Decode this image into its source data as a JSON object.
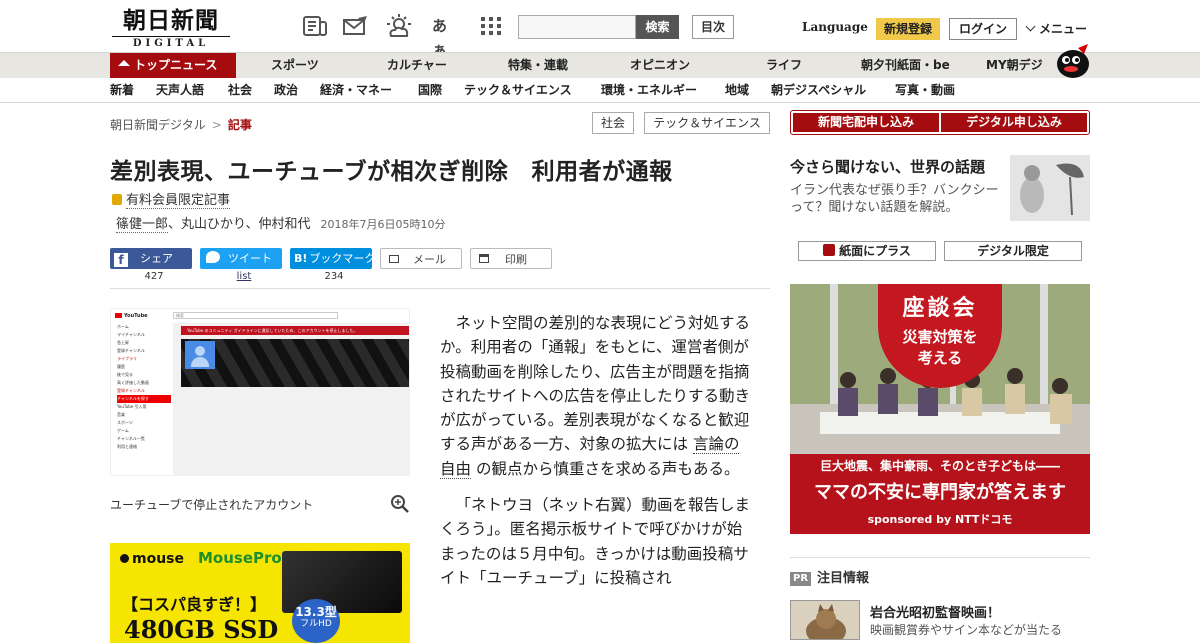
{
  "header": {
    "logo_jp": "朝日新聞",
    "logo_en": "DIGITAL",
    "icons": [
      "newspaper-icon",
      "mail-icon",
      "weather-icon",
      "font-size-icon",
      "apps-grid-icon"
    ],
    "font_icon_text": "あぁ",
    "search_placeholder": "",
    "search_button": "検索",
    "contents_button": "目次",
    "language": "Language",
    "register": "新規登録",
    "login": "ログイン",
    "menu": "メニュー"
  },
  "nav_primary": {
    "top": "トップニュース",
    "items": [
      "スポーツ",
      "カルチャー",
      "特集・連載",
      "オピニオン",
      "ライフ",
      "朝夕刊紙面・be",
      "MY朝デジ"
    ]
  },
  "nav_secondary": {
    "items": [
      "新着",
      "天声人語",
      "社会",
      "政治",
      "経済・マネー",
      "国際",
      "テック＆サイエンス",
      "環境・エネルギー",
      "地域",
      "朝デジスペシャル",
      "写真・動画"
    ]
  },
  "breadcrumb": {
    "home": "朝日新聞デジタル",
    "sep": ">",
    "current": "記事"
  },
  "tags": [
    "社会",
    "テック＆サイエンス"
  ],
  "article": {
    "title": "差別表現、ユーチューブが相次ぎ削除　利用者が通報",
    "paid_label": "有料会員限定記事",
    "author_main": "篠健一郎",
    "authors_rest": "、丸山ひかり、仲村和代",
    "date": "2018年7月6日05時10分",
    "photo_caption": "ユーチューブで停止されたアカウント",
    "paragraph1_a": "ネット空間の差別的な表現にどう対処するか。利用者の「通報」をもとに、運営者側が投稿動画を削除したり、広告主が問題を指摘されたサイトへの広告を停止したりする動きが広がっている。差別表現がなくなると歓迎する声がある一方、対象の拡大には",
    "paragraph1_link": "言論の自由",
    "paragraph1_b": "の観点から慎重さを求める声もある。",
    "paragraph2": "「ネトウヨ（ネット右翼）動画を報告しまくろう」。匿名掲示板サイトで呼びかけが始まったのは５月中旬。きっかけは動画投稿サイト「ユーチューブ」に投稿され"
  },
  "share": {
    "facebook": "シェア",
    "facebook_count": "427",
    "twitter": "ツイート",
    "twitter_count": "list",
    "hatena": "ブックマーク",
    "hatena_count": "234",
    "mail": "メール",
    "print": "印刷"
  },
  "screenshot": {
    "yt_logo": "YouTube",
    "search_text": "検索",
    "alert": "YouTube のコミュニティ ガイドラインに違反していたため、このアカウントを停止しました。",
    "side_items": [
      "ホーム",
      "マイチャンネル",
      "急上昇",
      "登録チャンネル",
      "ライブラリ",
      "履歴",
      "後で見る",
      "高く評価した動画",
      "登録チャンネル",
      "チャンネルを探す",
      "YouTube 引入用",
      "音楽",
      "スポーツ",
      "ゲーム",
      "チャンネル一覧",
      "利用と連絡"
    ]
  },
  "ad": {
    "brand": "mouse",
    "brand2": "MousePro",
    "copy": "【コスパ良すぎ！】",
    "big": "480GB SSD",
    "size": "13.3型",
    "size2": "フルHD"
  },
  "right": {
    "subscribe_paper": "新聞宅配申し込み",
    "subscribe_digital": "デジタル申し込み",
    "feature_title": "今さら聞けない、世界の話題",
    "feature_text": "イラン代表なぜ張り手？バンクシーって？聞けない話題を解説。",
    "btn_plus": "紙面にプラス",
    "btn_limited": "デジタル限定",
    "banner_title": "座談会",
    "banner_sub1": "災害対策を",
    "banner_sub2": "考える",
    "banner_line": "巨大地震、集中豪雨、そのとき子どもは――",
    "banner_big": "ママの不安に専門家が答えます",
    "banner_sponsor": "sponsored by NTTドコモ",
    "pr_badge": "PR",
    "pr_heading": "注目情報",
    "pr_title": "岩合光昭初監督映画！",
    "pr_sub": "映画観賞券やサイン本などが当たる"
  },
  "colors": {
    "brand_red": "#a40c0f",
    "nav_bg": "#e8e6e1",
    "register_yellow": "#f1c94a",
    "facebook": "#3b5998",
    "twitter": "#1da1f2",
    "hatena": "#008fde"
  }
}
